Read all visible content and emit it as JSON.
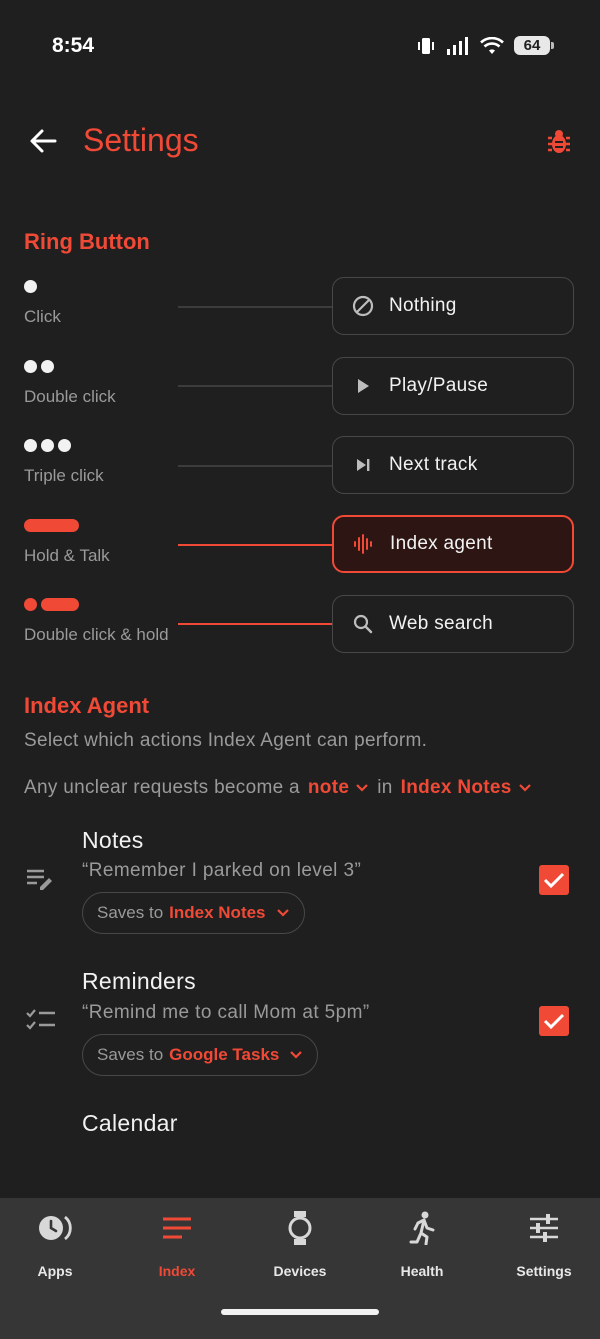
{
  "status_bar": {
    "time": "8:54",
    "battery": "64"
  },
  "header": {
    "title": "Settings"
  },
  "ring_button": {
    "section_title": "Ring Button",
    "rows": [
      {
        "gesture": "Click",
        "action": "Nothing",
        "icon": "block-icon",
        "active": false
      },
      {
        "gesture": "Double click",
        "action": "Play/Pause",
        "icon": "play-icon",
        "active": false
      },
      {
        "gesture": "Triple click",
        "action": "Next track",
        "icon": "skip-next-icon",
        "active": false
      },
      {
        "gesture": "Hold & Talk",
        "action": "Index agent",
        "icon": "voice-wave-icon",
        "active": true
      },
      {
        "gesture": "Double click & hold",
        "action": "Web search",
        "icon": "search-icon",
        "active": false
      }
    ]
  },
  "index_agent": {
    "section_title": "Index Agent",
    "description": "Select which actions Index Agent can perform.",
    "unclear": {
      "prefix": "Any unclear requests become a",
      "type_value": "note",
      "middle": "in",
      "destination_value": "Index Notes"
    },
    "actions": [
      {
        "title": "Notes",
        "example": "“Remember I parked on level 3”",
        "saves_prefix": "Saves to",
        "saves_target": "Index Notes",
        "checked": true
      },
      {
        "title": "Reminders",
        "example": "“Remind me to call Mom at 5pm”",
        "saves_prefix": "Saves to",
        "saves_target": "Google Tasks",
        "checked": true
      },
      {
        "title": "Calendar"
      }
    ]
  },
  "bottom_nav": {
    "items": [
      {
        "label": "Apps",
        "icon": "apps-clock-icon",
        "active": false
      },
      {
        "label": "Index",
        "icon": "menu-lines-icon",
        "active": true
      },
      {
        "label": "Devices",
        "icon": "watch-icon",
        "active": false
      },
      {
        "label": "Health",
        "icon": "running-icon",
        "active": false
      },
      {
        "label": "Settings",
        "icon": "sliders-icon",
        "active": false
      }
    ]
  },
  "colors": {
    "accent": "#f04a37",
    "background": "#1f1f1f",
    "nav_background": "#363636"
  }
}
